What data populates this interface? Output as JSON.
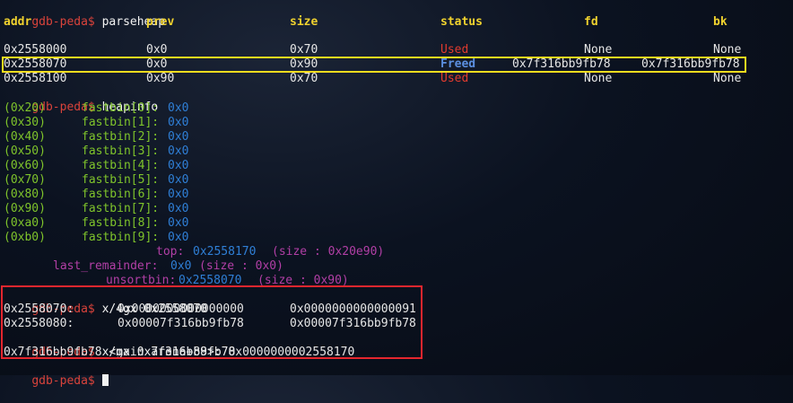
{
  "prompt": "gdb-peda$",
  "commands": {
    "parseheap": "parseheap",
    "heapinfo": "heapinfo",
    "x4gx": "x/4gx 0x2558070",
    "xgx": "x/gx 0x7f316bb9fb78"
  },
  "parseheap": {
    "headers": [
      "addr",
      "prev",
      "size",
      "status",
      "fd",
      "bk"
    ],
    "rows": [
      {
        "addr": "0x2558000",
        "prev": "0x0",
        "size": "0x70",
        "status": "Used",
        "fd": "None",
        "bk": "None"
      },
      {
        "addr": "0x2558070",
        "prev": "0x0",
        "size": "0x90",
        "status": "Freed",
        "fd": "0x7f316bb9fb78",
        "bk": "0x7f316bb9fb78"
      },
      {
        "addr": "0x2558100",
        "prev": "0x90",
        "size": "0x70",
        "status": "Used",
        "fd": "None",
        "bk": "None"
      }
    ]
  },
  "fastbins": [
    {
      "size": "(0x20)",
      "name": "fastbin[0]:",
      "value": "0x0"
    },
    {
      "size": "(0x30)",
      "name": "fastbin[1]:",
      "value": "0x0"
    },
    {
      "size": "(0x40)",
      "name": "fastbin[2]:",
      "value": "0x0"
    },
    {
      "size": "(0x50)",
      "name": "fastbin[3]:",
      "value": "0x0"
    },
    {
      "size": "(0x60)",
      "name": "fastbin[4]:",
      "value": "0x0"
    },
    {
      "size": "(0x70)",
      "name": "fastbin[5]:",
      "value": "0x0"
    },
    {
      "size": "(0x80)",
      "name": "fastbin[6]:",
      "value": "0x0"
    },
    {
      "size": "(0x90)",
      "name": "fastbin[7]:",
      "value": "0x0"
    },
    {
      "size": "(0xa0)",
      "name": "fastbin[8]:",
      "value": "0x0"
    },
    {
      "size": "(0xb0)",
      "name": "fastbin[9]:",
      "value": "0x0"
    }
  ],
  "heap_special": {
    "top_label": "top:",
    "top_value": "0x2558170",
    "top_size": "(size : 0x20e90)",
    "last_label": "last_remainder:",
    "last_value": "0x0",
    "last_size": "(size : 0x0)",
    "unsorted_label": "unsortbin:",
    "unsorted_value": "0x2558070",
    "unsorted_size": "(size : 0x90)"
  },
  "memdump": [
    {
      "addr": "0x2558070:",
      "v1": "0x0000000000000000",
      "v2": "0x0000000000000091"
    },
    {
      "addr": "0x2558080:",
      "v1": "0x00007f316bb9fb78",
      "v2": "0x00007f316bb9fb78"
    }
  ],
  "xgx_output": "0x7f316bb9fb78 <main_arena+88>: 0x0000000002558170",
  "colors": {
    "prompt": "#d9433b",
    "header": "#f0d22e",
    "used": "#e23b2e",
    "freed": "#5b8fe0",
    "green": "#7fc42b",
    "blue": "#2f7fd6",
    "purple": "#b23fa6",
    "highlight_box": "#f5dc1e",
    "red_box": "#e5262e"
  }
}
